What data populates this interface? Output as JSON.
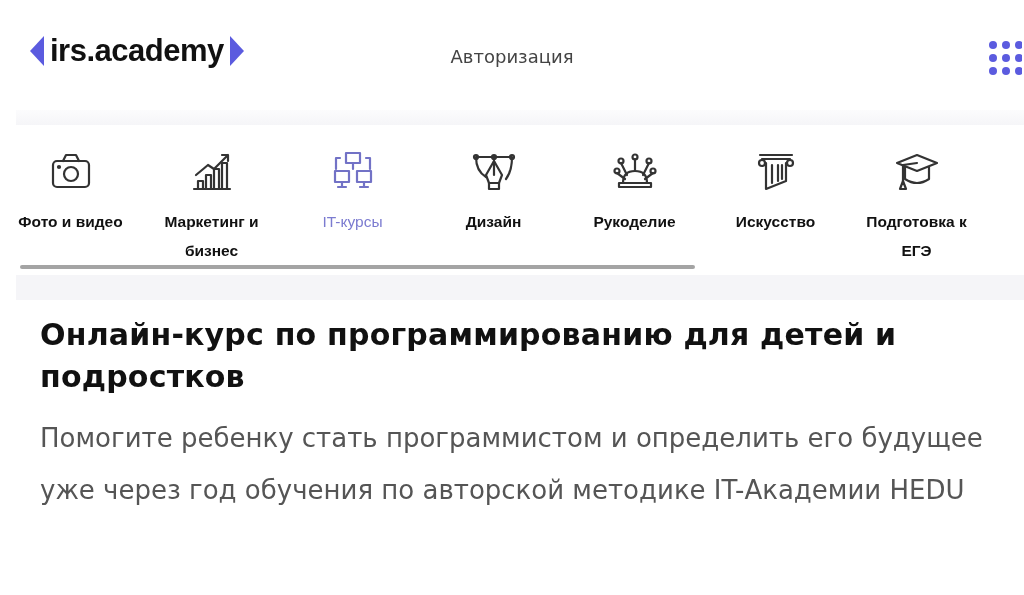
{
  "header": {
    "logo": "irs.academy",
    "login_link": "Авторизация"
  },
  "categories": [
    {
      "label": "Фото и видео",
      "selected": false
    },
    {
      "label": "Маркетинг и бизнес",
      "selected": false
    },
    {
      "label": "IT-курсы",
      "selected": true
    },
    {
      "label": "Дизайн",
      "selected": false
    },
    {
      "label": "Рукоделие",
      "selected": false
    },
    {
      "label": "Искусство",
      "selected": false
    },
    {
      "label": "Подготовка к ЕГЭ",
      "selected": false
    }
  ],
  "hero": {
    "title": "Онлайн-курс по программированию для детей и подростков",
    "subtitle": "Помогите ребенку стать программистом и определить его будущее уже через год обучения по авторской методике IT-Академии HEDU"
  }
}
